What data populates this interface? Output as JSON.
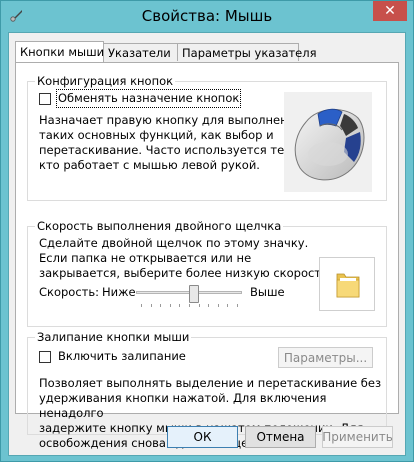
{
  "window": {
    "title": "Свойства: Мышь"
  },
  "tabs": [
    {
      "label": "Кнопки мыши",
      "active": true
    },
    {
      "label": "Указатели",
      "active": false
    },
    {
      "label": "Параметры указателя",
      "active": false
    }
  ],
  "button_config": {
    "group_label": "Конфигурация кнопок",
    "swap_checkbox_label": "Обменять назначение кнопок",
    "swap_checked": false,
    "description_lines": [
      "Назначает правую кнопку для выполнения",
      "таких основных функций, как выбор и",
      "перетаскивание. Часто используется теми,",
      "кто работает с мышью левой рукой."
    ]
  },
  "double_click": {
    "group_label": "Скорость выполнения двойного щелчка",
    "description_lines": [
      "Сделайте двойной щелчок по этому значку.",
      "Если папка не открывается или не",
      "закрывается, выберите более низкую скорость."
    ],
    "speed_label": "Скорость:",
    "slow_label": "Ниже",
    "fast_label": "Выше",
    "slider_value_fraction": 0.55
  },
  "click_lock": {
    "group_label": "Залипание кнопки мыши",
    "checkbox_label": "Включить залипание",
    "checked": false,
    "settings_button": "Параметры...",
    "description_lines": [
      "Позволяет выполнять выделение и перетаскивание без",
      "удерживания кнопки нажатой. Для включения ненадолго",
      "задержите кнопку мыши в нажатом положении. Для",
      "освобождения снова сделайте щелчок."
    ]
  },
  "footer": {
    "ok": "ОК",
    "cancel": "Отмена",
    "apply": "Применить"
  },
  "colors": {
    "window_frame": "#6cc3d0",
    "close_button": "#c7504b",
    "folder": "#f2d36a"
  }
}
